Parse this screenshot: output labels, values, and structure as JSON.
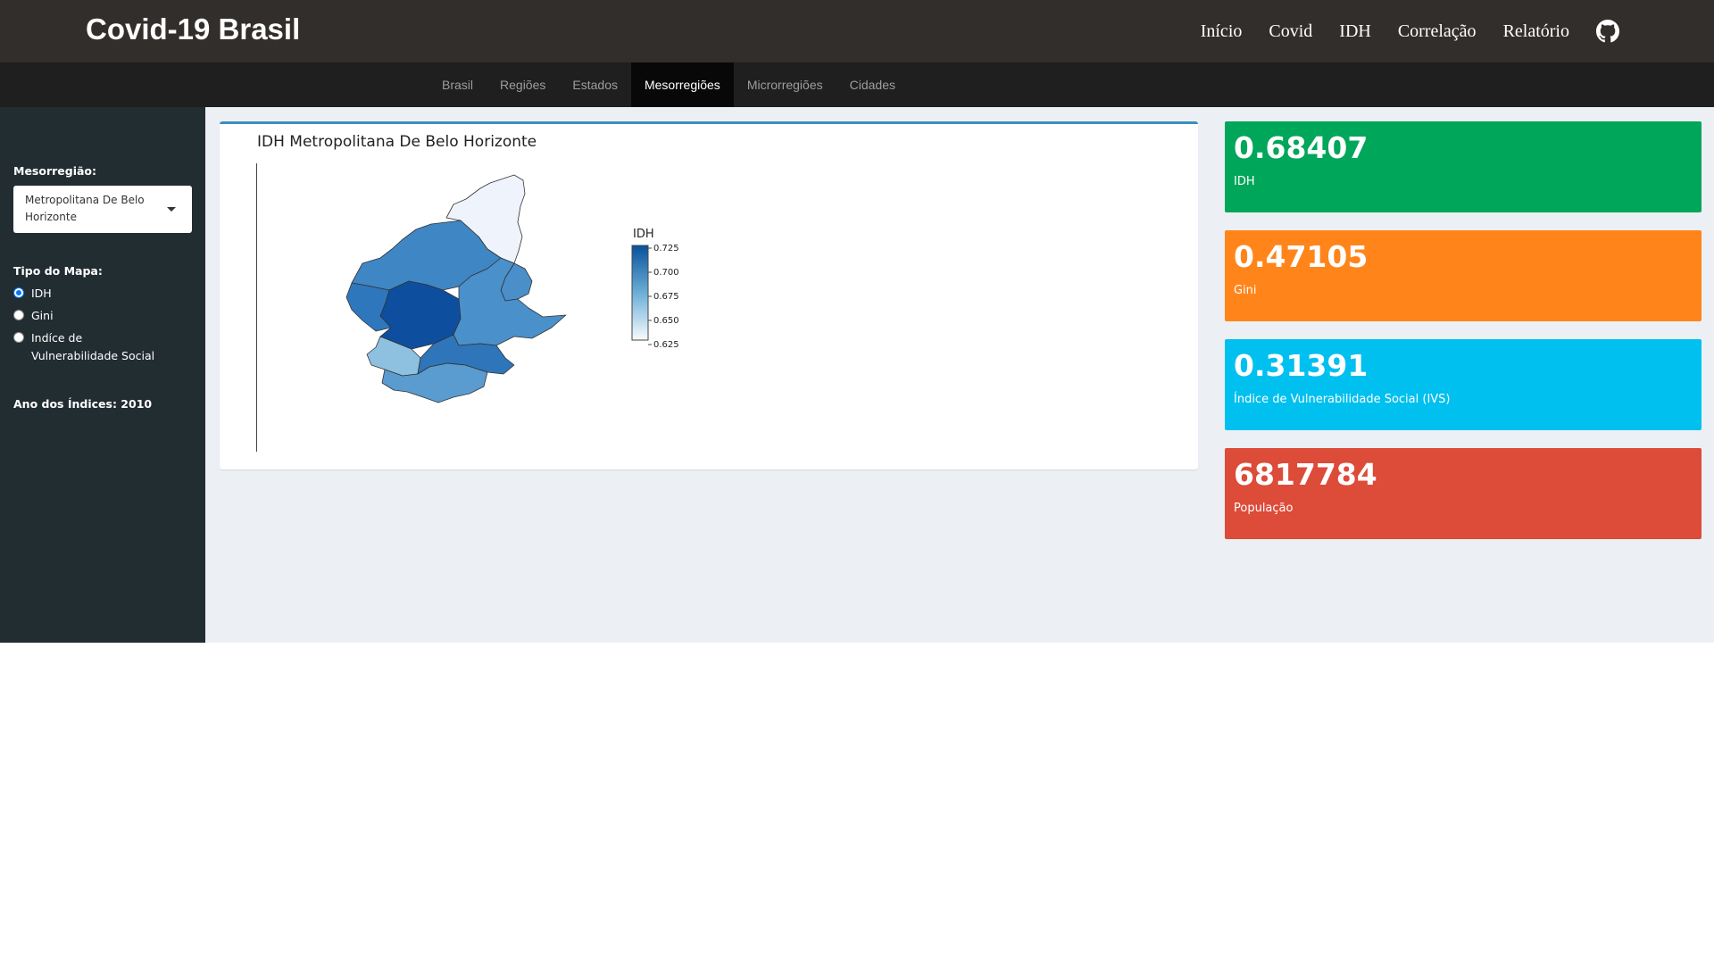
{
  "header": {
    "brand": "Covid-19 Brasil",
    "nav": [
      "Início",
      "Covid",
      "IDH",
      "Correlação",
      "Relatório"
    ],
    "github_icon": "github-icon"
  },
  "subnav": {
    "tabs": [
      "Brasil",
      "Regiões",
      "Estados",
      "Mesorregiões",
      "Microrregiões",
      "Cidades"
    ],
    "active": "Mesorregiões"
  },
  "sidebar": {
    "mesorregiao_label": "Mesorregião:",
    "mesorregiao_value": "Metropolitana De Belo Horizonte",
    "tipo_label": "Tipo do Mapa:",
    "tipo_options": [
      "IDH",
      "Gini",
      "Indíce de Vulnerabilidade Social"
    ],
    "tipo_selected": "IDH",
    "ano_label": "Ano dos Índices: 2010"
  },
  "map": {
    "title": "IDH Metropolitana De Belo Horizonte",
    "legend_title": "IDH",
    "legend_ticks": [
      "0.725",
      "0.700",
      "0.675",
      "0.650",
      "0.625"
    ],
    "colors": {
      "low": "#f7fbff",
      "high": "#08519c"
    }
  },
  "stats": [
    {
      "value": "0.68407",
      "label": "IDH",
      "color": "#00a65a"
    },
    {
      "value": "0.47105",
      "label": "Gini",
      "color": "#ff851b"
    },
    {
      "value": "0.31391",
      "label": "Índice de Vulnerabilidade Social (IVS)",
      "color": "#00c0ef"
    },
    {
      "value": "6817784",
      "label": "População",
      "color": "#dd4b39"
    }
  ]
}
